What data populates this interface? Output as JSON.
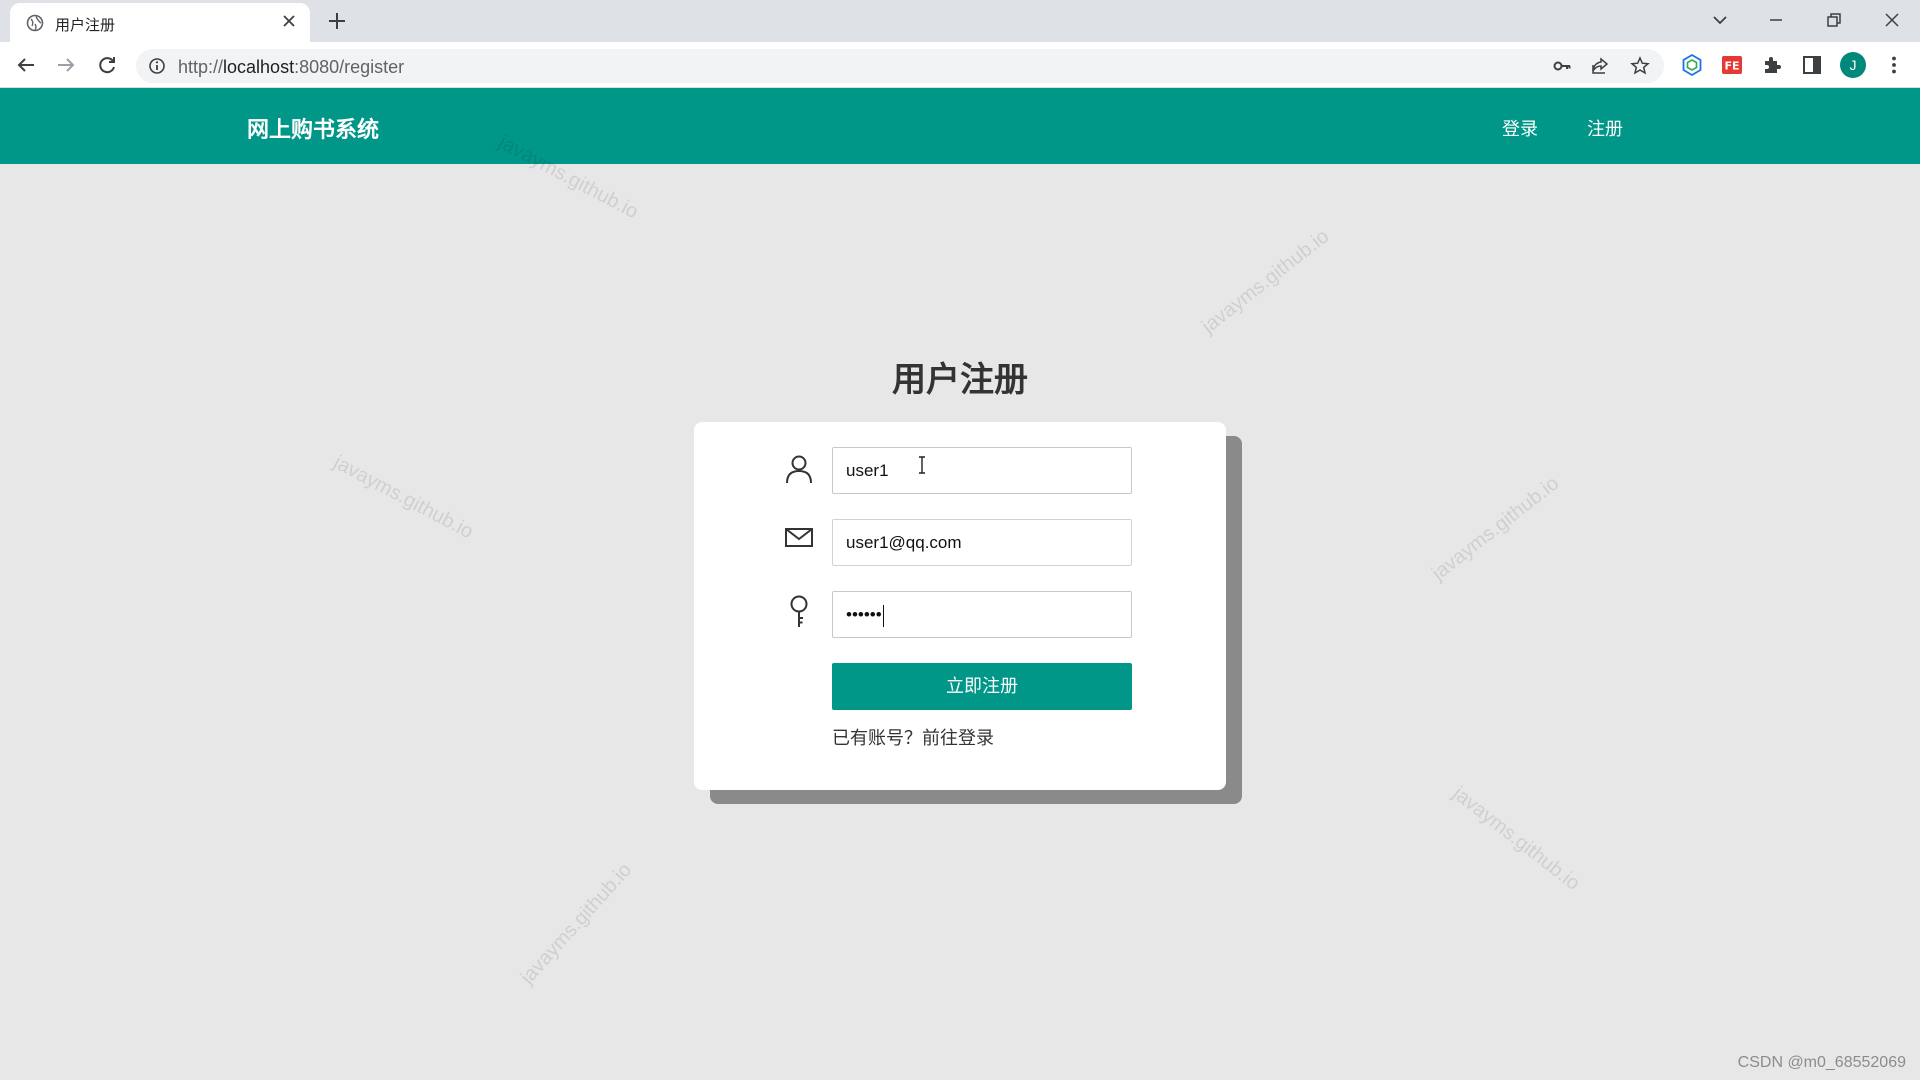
{
  "browser": {
    "tab_title": "用户注册",
    "url_prefix": "http://",
    "url_host": "localhost",
    "url_path": ":8080/register",
    "profile_initial": "J"
  },
  "navbar": {
    "brand": "网上购书系统",
    "login_label": "登录",
    "register_label": "注册",
    "color": "#009688"
  },
  "form": {
    "title": "用户注册",
    "username_value": "user1",
    "email_value": "user1@qq.com",
    "password_value": "••••••",
    "submit_label": "立即注册",
    "login_prompt": "已有账号？前往登录"
  },
  "watermark_text": "javayms.github.io",
  "credit": "CSDN @m0_68552069"
}
